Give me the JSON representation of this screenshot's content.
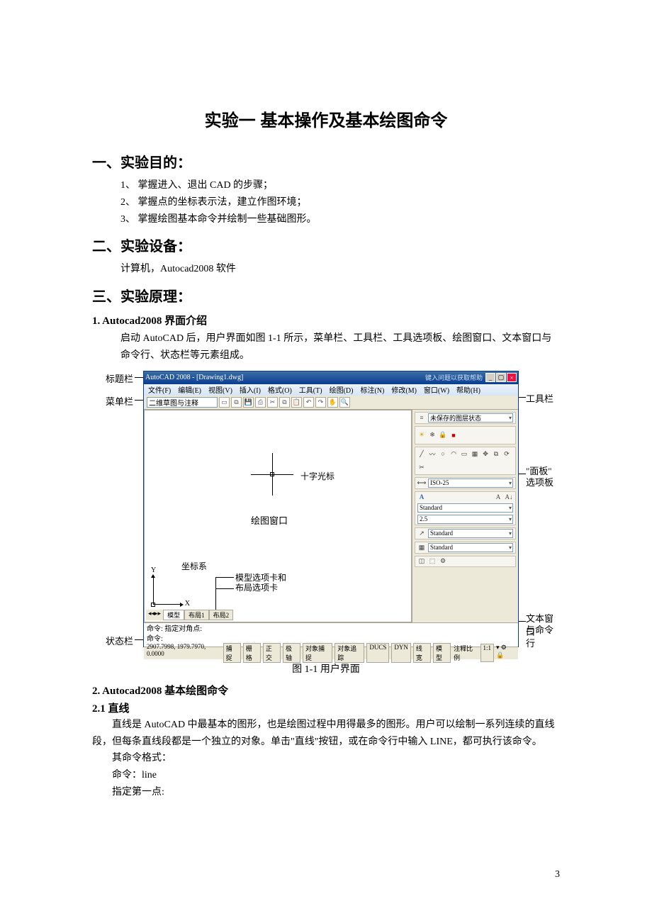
{
  "title": "实验一  基本操作及基本绘图命令",
  "s1": {
    "heading": "一、实验目的：",
    "items": [
      "1、 掌握进入、退出 CAD 的步骤；",
      "2、 掌握点的坐标表示法，建立作图环境；",
      "3、 掌握绘图基本命令并绘制一些基础图形。"
    ]
  },
  "s2": {
    "heading": "二、实验设备：",
    "body": "计算机，Autocad2008 软件"
  },
  "s3": {
    "heading": "三、实验原理：",
    "sub1": {
      "heading": "1.    Autocad2008 界面介绍",
      "p": "启动 AutoCAD 后，用户界面如图 1-1 所示，菜单栏、工具栏、工具选项板、绘图窗口、文本窗口与命令行、状态栏等元素组成。"
    },
    "caption": "图 1-1    用户界面",
    "sub2": {
      "heading": "2.    Autocad2008 基本绘图命令",
      "s21h": "2.1    直线",
      "p1": "直线是 AutoCAD 中最基本的图形，也是绘图过程中用得最多的图形。用户可以绘制一系列连续的直线段，但每条直线段都是一个独立的对象。单击\"直线\"按钮，或在命令行中输入 LINE，都可执行该命令。",
      "p2a": "其命令格式：",
      "p2b": "命令：line",
      "p2c": "指定第一点:"
    }
  },
  "fig": {
    "labels_left": {
      "titlebar": "标题栏",
      "menubar": "菜单栏",
      "status": "状态栏"
    },
    "labels_right": {
      "toolbar": "工具栏",
      "panel1": "\"面板\"",
      "panel2": "选项板",
      "cmdwin1": "文本窗口",
      "cmdwin2": "与命令行"
    },
    "labels_in": {
      "cross": "十字光标",
      "canvas": "绘图窗口",
      "ucs": "坐标系",
      "tabs1": "模型选项卡和",
      "tabs2": "布局选项卡"
    },
    "cad": {
      "title": "AutoCAD 2008 - [Drawing1.dwg]",
      "search_hint": "键入问题以获取帮助",
      "menus": [
        "文件(F)",
        "编辑(E)",
        "视图(V)",
        "插入(I)",
        "格式(O)",
        "工具(T)",
        "绘图(D)",
        "标注(N)",
        "修改(M)",
        "窗口(W)",
        "帮助(H)"
      ],
      "dropdown": "二维草图与注释",
      "tabs": [
        "模型",
        "布局1",
        "布局2"
      ],
      "cmd1": "命令: 指定对角点:",
      "cmd2": "命令:",
      "coords": "2907.7998, 1979.7970, 0.0000",
      "status_btns": [
        "捕捉",
        "栅格",
        "正交",
        "极轴",
        "对象捕捉",
        "对象追踪",
        "DUCS",
        "DYN",
        "线宽",
        "模型"
      ],
      "scale_label": "注释比例",
      "scale_value": "1:1",
      "panel": {
        "layer_state": "未保存的图层状态",
        "iso": "ISO-25",
        "standard": "Standard",
        "size": "2.5"
      }
    }
  },
  "page_number": "3"
}
